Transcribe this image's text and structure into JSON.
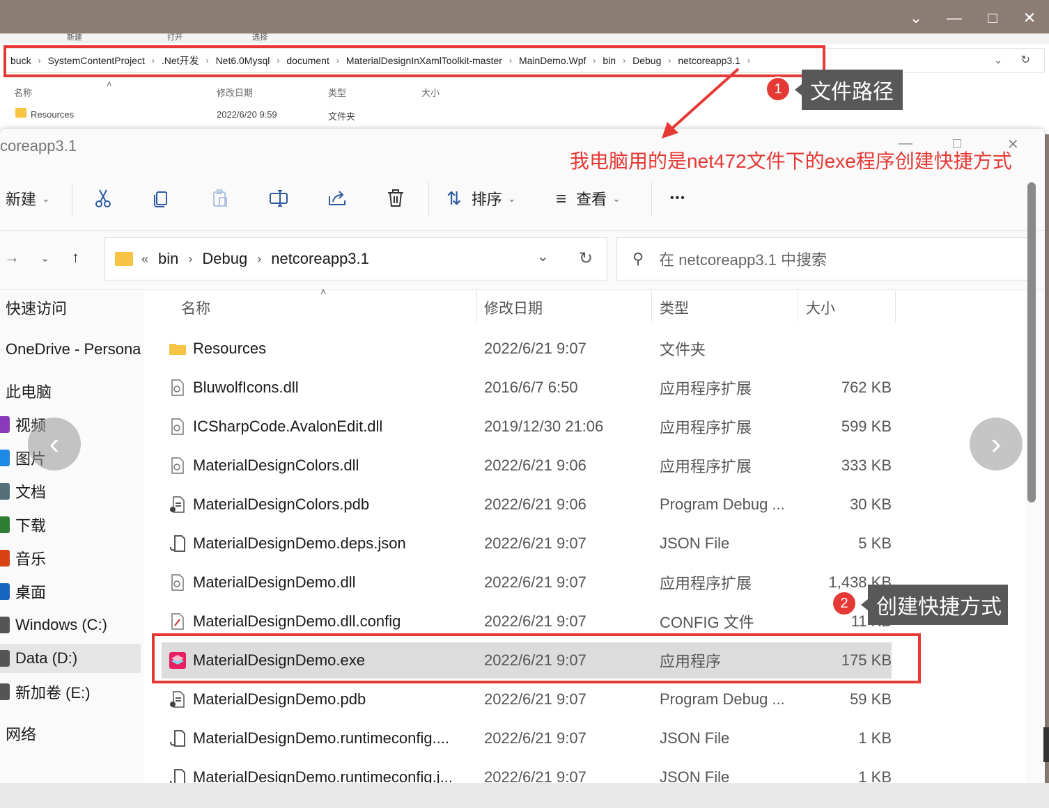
{
  "back_window": {
    "strip_items": [
      "新建",
      "打开",
      "选择"
    ],
    "crumbs": [
      "buck",
      "SystemContentProject",
      ".Net开发",
      "Net6.0Mysql",
      "document",
      "MaterialDesignInXamlToolkit-master",
      "MainDemo.Wpf",
      "bin",
      "Debug",
      "netcoreapp3.1"
    ],
    "headers": {
      "name": "名称",
      "date": "修改日期",
      "type": "类型",
      "size": "大小"
    },
    "row": {
      "name": "Resources",
      "date": "2022/6/20 9:59",
      "type": "文件夹"
    }
  },
  "annotations": {
    "badge1": "1",
    "tip1": "文件路径",
    "note": "我电脑用的是net472文件下的exe程序创建快捷方式",
    "badge2": "2",
    "tip2": "创建快捷方式"
  },
  "front_window": {
    "title": "coreapp3.1",
    "toolbar": {
      "new_label": "新建",
      "sort_label": "排序",
      "view_label": "查看",
      "more_label": "•••"
    },
    "address": {
      "overflow": "«",
      "crumbs": [
        "bin",
        "Debug",
        "netcoreapp3.1"
      ]
    },
    "search": {
      "placeholder": "在 netcoreapp3.1 中搜索"
    },
    "sidebar": [
      {
        "label": "快速访问",
        "icon": "star-icon",
        "color": ""
      },
      {
        "label": "OneDrive - Persona",
        "icon": "cloud-icon",
        "color": ""
      },
      {
        "label": "此电脑",
        "icon": "pc-icon",
        "color": ""
      },
      {
        "label": "视频",
        "icon": "video-icon",
        "color": "#8a3ab9"
      },
      {
        "label": "图片",
        "icon": "picture-icon",
        "color": "#1e88e5"
      },
      {
        "label": "文档",
        "icon": "document-icon",
        "color": "#546e7a"
      },
      {
        "label": "下载",
        "icon": "download-icon",
        "color": "#2e7d32"
      },
      {
        "label": "音乐",
        "icon": "music-icon",
        "color": "#d84315"
      },
      {
        "label": "桌面",
        "icon": "desktop-icon",
        "color": "#1565c0"
      },
      {
        "label": "Windows (C:)",
        "icon": "drive-icon",
        "color": "#555555"
      },
      {
        "label": "Data (D:)",
        "icon": "drive-icon",
        "color": "#555555",
        "selected": true
      },
      {
        "label": "新加卷 (E:)",
        "icon": "drive-icon",
        "color": "#555555"
      },
      {
        "label": "网络",
        "icon": "network-icon",
        "color": ""
      }
    ],
    "columns": {
      "name": "名称",
      "date": "修改日期",
      "type": "类型",
      "size": "大小"
    },
    "files": [
      {
        "name": "Resources",
        "date": "2022/6/21 9:07",
        "type": "文件夹",
        "size": "",
        "icon": "folder-icon"
      },
      {
        "name": "BluwolfIcons.dll",
        "date": "2016/6/7 6:50",
        "type": "应用程序扩展",
        "size": "762 KB",
        "icon": "dll-icon"
      },
      {
        "name": "ICSharpCode.AvalonEdit.dll",
        "date": "2019/12/30 21:06",
        "type": "应用程序扩展",
        "size": "599 KB",
        "icon": "dll-icon"
      },
      {
        "name": "MaterialDesignColors.dll",
        "date": "2022/6/21 9:06",
        "type": "应用程序扩展",
        "size": "333 KB",
        "icon": "dll-icon"
      },
      {
        "name": "MaterialDesignColors.pdb",
        "date": "2022/6/21 9:06",
        "type": "Program Debug ...",
        "size": "30 KB",
        "icon": "pdb-icon"
      },
      {
        "name": "MaterialDesignDemo.deps.json",
        "date": "2022/6/21 9:07",
        "type": "JSON File",
        "size": "5 KB",
        "icon": "json-icon"
      },
      {
        "name": "MaterialDesignDemo.dll",
        "date": "2022/6/21 9:07",
        "type": "应用程序扩展",
        "size": "1,438 KB",
        "icon": "dll-icon"
      },
      {
        "name": "MaterialDesignDemo.dll.config",
        "date": "2022/6/21 9:07",
        "type": "CONFIG 文件",
        "size": "11 KB",
        "icon": "config-icon"
      },
      {
        "name": "MaterialDesignDemo.exe",
        "date": "2022/6/21 9:07",
        "type": "应用程序",
        "size": "175 KB",
        "icon": "exe-icon",
        "selected": true
      },
      {
        "name": "MaterialDesignDemo.pdb",
        "date": "2022/6/21 9:07",
        "type": "Program Debug ...",
        "size": "59 KB",
        "icon": "pdb-icon"
      },
      {
        "name": "MaterialDesignDemo.runtimeconfig....",
        "date": "2022/6/21 9:07",
        "type": "JSON File",
        "size": "1 KB",
        "icon": "json-icon"
      },
      {
        "name": "MaterialDesignDemo.runtimeconfig.j...",
        "date": "2022/6/21 9:07",
        "type": "JSON File",
        "size": "1 KB",
        "icon": "json-icon"
      }
    ]
  },
  "colors": {
    "annotation_red": "#e53935",
    "tip_bg": "#585858",
    "selection": "#dcdcdc",
    "exe_icon": "#e91e63"
  }
}
